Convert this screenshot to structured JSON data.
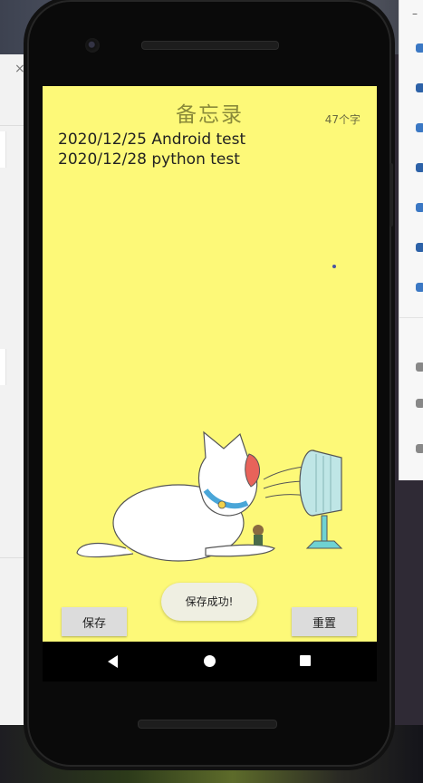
{
  "app": {
    "title": "备忘录",
    "char_count": "47个字",
    "memo_lines": [
      "2020/12/25 Android test",
      "2020/12/28 python test"
    ],
    "save_label": "保存",
    "reset_label": "重置",
    "toast": "保存成功!"
  },
  "nav": {
    "back_icon": "back-triangle-icon",
    "home_icon": "home-circle-icon",
    "recent_icon": "recent-apps-square-icon"
  },
  "desktop": {
    "close_glyph": "×",
    "dash_glyph": "–"
  },
  "colors": {
    "screen_background": "#fdf978",
    "title": "#8a8a3a",
    "button": "#dcdcdc",
    "toast": "#efefe2"
  }
}
